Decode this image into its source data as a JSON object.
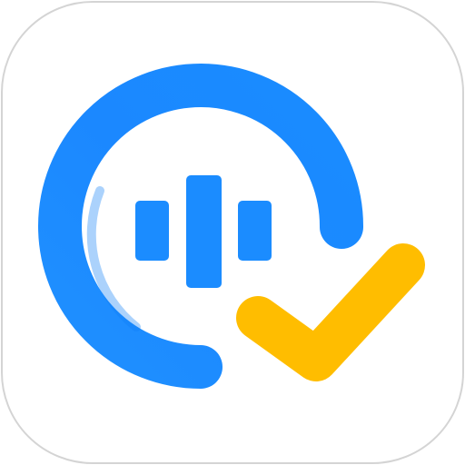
{
  "app_icon": {
    "icon": "voice-check-app-icon",
    "colors": {
      "tile_background": "#ffffff",
      "tile_border": "#d4d4d4",
      "ring_blue": "#1a8cff",
      "ring_blue_dark": "#0a6ee8",
      "bars_blue": "#1b8cff",
      "check_yellow": "#ffbd00"
    },
    "parts": {
      "ring": "partial-ring-icon",
      "sound_bars": "sound-bars-icon",
      "checkmark": "checkmark-icon"
    }
  }
}
